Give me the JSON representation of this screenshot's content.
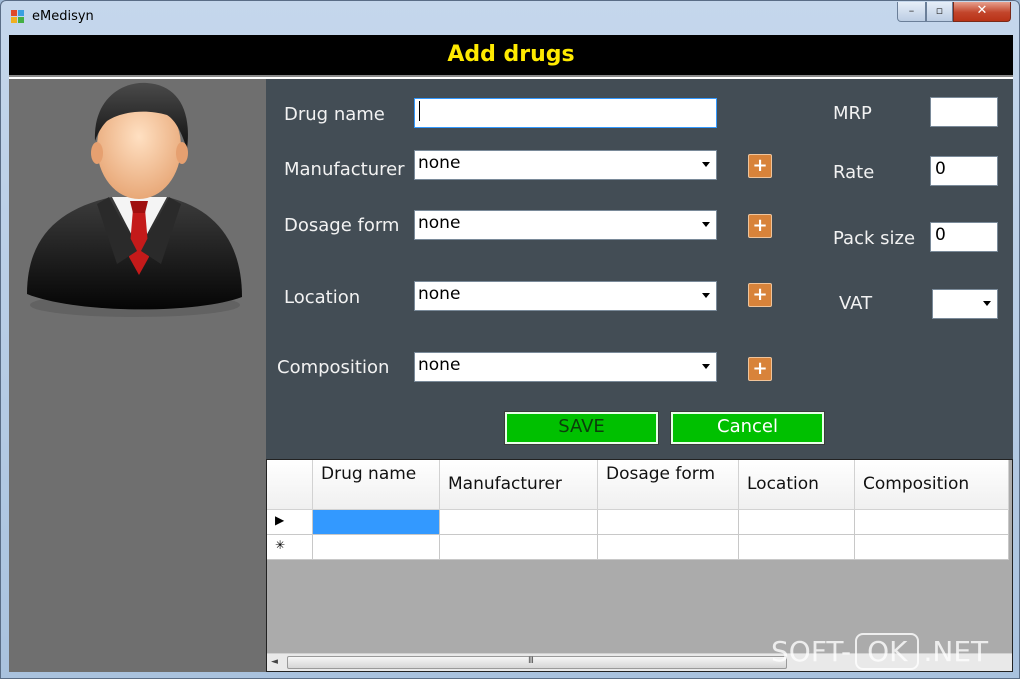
{
  "window": {
    "title": "eMedisyn",
    "controls": {
      "minimize": "–",
      "maximize": "▫",
      "close": "✕"
    }
  },
  "header": {
    "title": "Add drugs"
  },
  "form": {
    "drug_name": {
      "label": "Drug name",
      "value": ""
    },
    "manufacturer": {
      "label": "Manufacturer",
      "value": "none"
    },
    "dosage_form": {
      "label": "Dosage form",
      "value": "none"
    },
    "location": {
      "label": "Location",
      "value": "none"
    },
    "composition": {
      "label": "Composition",
      "value": "none"
    },
    "mrp": {
      "label": "MRP",
      "value": ""
    },
    "rate": {
      "label": "Rate",
      "value": "0"
    },
    "pack_size": {
      "label": "Pack size",
      "value": "0"
    },
    "vat": {
      "label": "VAT",
      "value": ""
    },
    "add_glyph": "+",
    "save_label": "SAVE",
    "cancel_label": "Cancel"
  },
  "grid": {
    "columns": [
      "Drug name",
      "Manufacturer",
      "Dosage form",
      "Location",
      "Composition"
    ],
    "rows": [
      {
        "marker": "▶",
        "cells": [
          "",
          "",
          "",
          "",
          ""
        ]
      },
      {
        "marker": "✳",
        "cells": [
          "",
          "",
          "",
          "",
          ""
        ]
      }
    ],
    "scroll": {
      "left_arrow": "◄",
      "grip": "III"
    }
  },
  "watermark": {
    "left": "SOFT-",
    "middle": "OK",
    "right": ".NET"
  },
  "colors": {
    "header_bg": "#000000",
    "header_text": "#ffea00",
    "form_bg": "#434d55",
    "side_bg": "#6f6f6f",
    "button_green": "#00c000",
    "plus_orange": "#d8833a",
    "selection_blue": "#3399ff"
  }
}
